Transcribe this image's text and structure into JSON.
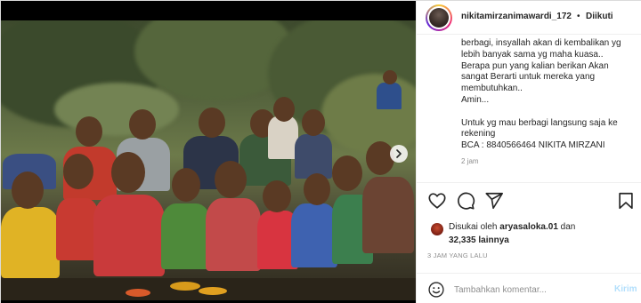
{
  "post": {
    "author": {
      "username": "nikitamirzanimawardi_172",
      "separator": "•",
      "follow_state": "Diikuti"
    },
    "caption_lines": [
      "berbagi, insyallah akan di kembalikan yg",
      "lebih banyak sama yg maha kuasa..",
      "Berapa pun yang kalian berikan Akan",
      "sangat Berarti untuk mereka yang",
      "membutuhkan..",
      "Amin...",
      "",
      "Untuk yg mau berbagi langsung saja ke",
      "rekening",
      "BCA : 8840566464 NIKITA MIRZANI"
    ],
    "caption_time_peek": "2 jam",
    "actions": {
      "like_icon": "heart-icon",
      "comment_icon": "comment-icon",
      "share_icon": "paper-plane-icon",
      "save_icon": "bookmark-icon"
    },
    "likes": {
      "prefix": "Disukai oleh ",
      "liker": "aryasaloka.01",
      "conjunction": " dan",
      "others_count": "32,335",
      "others_suffix": " lainnya"
    },
    "timestamp": "3 JAM YANG LALU",
    "comment": {
      "emoji_icon": "smiley-icon",
      "placeholder": "Tambahkan komentar...",
      "submit_label": "Kirim"
    },
    "media": {
      "next_icon": "chevron-right-icon"
    }
  },
  "colors": {
    "text": "#262626",
    "secondary": "#8e8e8e",
    "border": "#dbdbdb",
    "post_button_disabled": "#b2dffc"
  }
}
